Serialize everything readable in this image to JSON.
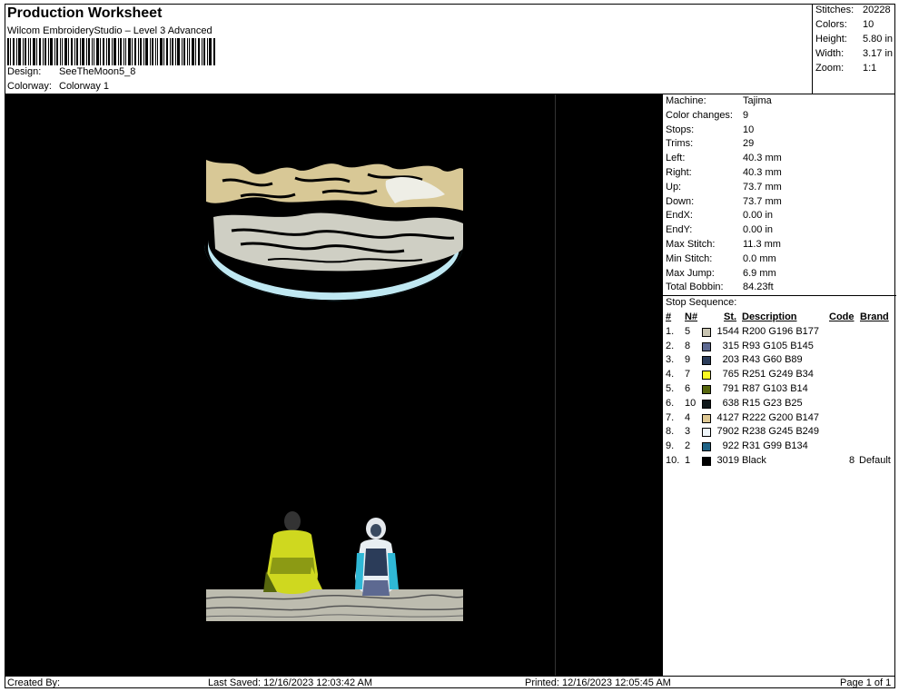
{
  "header": {
    "title": "Production Worksheet",
    "subtitle": "Wilcom EmbroideryStudio – Level 3 Advanced",
    "design_label": "Design:",
    "design_value": "SeeTheMoon5_8",
    "colorway_label": "Colorway:",
    "colorway_value": "Colorway 1"
  },
  "stats": [
    {
      "label": "Stitches:",
      "value": "20228"
    },
    {
      "label": "Colors:",
      "value": "10"
    },
    {
      "label": "Height:",
      "value": "5.80 in"
    },
    {
      "label": "Width:",
      "value": "3.17 in"
    },
    {
      "label": "Zoom:",
      "value": "1:1"
    }
  ],
  "machine_info": [
    {
      "label": "Machine:",
      "value": "Tajima"
    },
    {
      "label": "Color changes:",
      "value": "9"
    },
    {
      "label": "Stops:",
      "value": "10"
    },
    {
      "label": "Trims:",
      "value": "29"
    },
    {
      "label": "Left:",
      "value": "40.3 mm"
    },
    {
      "label": "Right:",
      "value": "40.3 mm"
    },
    {
      "label": "Up:",
      "value": "73.7 mm"
    },
    {
      "label": "Down:",
      "value": "73.7 mm"
    },
    {
      "label": "EndX:",
      "value": "0.00 in"
    },
    {
      "label": "EndY:",
      "value": "0.00 in"
    },
    {
      "label": "Max Stitch:",
      "value": "11.3 mm"
    },
    {
      "label": "Min Stitch:",
      "value": "0.0 mm"
    },
    {
      "label": "Max Jump:",
      "value": "6.9 mm"
    },
    {
      "label": "Total Bobbin:",
      "value": "84.23ft"
    }
  ],
  "stop_sequence": {
    "title": "Stop Sequence:",
    "headers": {
      "num": "#",
      "needle": "N#",
      "stitches": "St.",
      "description": "Description",
      "code": "Code",
      "brand": "Brand"
    },
    "rows": [
      {
        "num": "1.",
        "needle": "5",
        "color": "#c8c4b1",
        "stitches": "1544",
        "description": "R200 G196 B177",
        "code": "",
        "brand": ""
      },
      {
        "num": "2.",
        "needle": "8",
        "color": "#5d6991",
        "stitches": "315",
        "description": "R93 G105 B145",
        "code": "",
        "brand": ""
      },
      {
        "num": "3.",
        "needle": "9",
        "color": "#2b3c59",
        "stitches": "203",
        "description": "R43 G60 B89",
        "code": "",
        "brand": ""
      },
      {
        "num": "4.",
        "needle": "7",
        "color": "#fbf922",
        "stitches": "765",
        "description": "R251 G249 B34",
        "code": "",
        "brand": ""
      },
      {
        "num": "5.",
        "needle": "6",
        "color": "#57670e",
        "stitches": "791",
        "description": "R87 G103 B14",
        "code": "",
        "brand": ""
      },
      {
        "num": "6.",
        "needle": "10",
        "color": "#0f1719",
        "stitches": "638",
        "description": "R15 G23 B25",
        "code": "",
        "brand": ""
      },
      {
        "num": "7.",
        "needle": "4",
        "color": "#dec893",
        "stitches": "4127",
        "description": "R222 G200 B147",
        "code": "",
        "brand": ""
      },
      {
        "num": "8.",
        "needle": "3",
        "color": "#eef5f9",
        "stitches": "7902",
        "description": "R238 G245 B249",
        "code": "",
        "brand": ""
      },
      {
        "num": "9.",
        "needle": "2",
        "color": "#1f6386",
        "stitches": "922",
        "description": "R31 G99 B134",
        "code": "",
        "brand": ""
      },
      {
        "num": "10.",
        "needle": "1",
        "color": "#000000",
        "stitches": "3019",
        "description": "Black",
        "code": "8",
        "brand": "Default"
      }
    ]
  },
  "footer": {
    "created_by": "Created By:",
    "last_saved": "Last Saved: 12/16/2023 12:03:42 AM",
    "printed": "Printed: 12/16/2023 12:05:45 AM",
    "page": "Page 1 of 1"
  }
}
